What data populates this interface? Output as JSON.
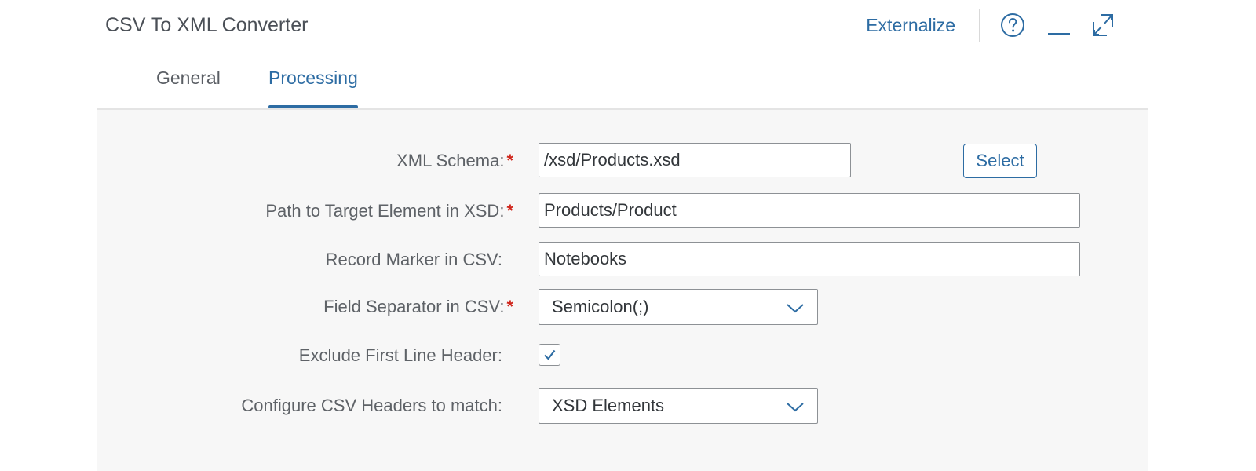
{
  "header": {
    "title": "CSV To XML Converter",
    "externalize_label": "Externalize",
    "icons": [
      "help-icon",
      "minimize-icon",
      "maximize-icon"
    ]
  },
  "tabs": [
    {
      "label": "General",
      "active": false
    },
    {
      "label": "Processing",
      "active": true
    }
  ],
  "form": {
    "xml_schema": {
      "label": "XML Schema:",
      "required": true,
      "value": "/xsd/Products.xsd",
      "button_label": "Select"
    },
    "target_path": {
      "label": "Path to Target Element in XSD:",
      "required": true,
      "value": "Products/Product"
    },
    "record_marker": {
      "label": "Record Marker in CSV:",
      "required": false,
      "value": "Notebooks"
    },
    "field_separator": {
      "label": "Field Separator in CSV:",
      "required": true,
      "value": "Semicolon(;)"
    },
    "exclude_header": {
      "label": "Exclude First Line Header:",
      "required": false,
      "checked": true
    },
    "configure_headers": {
      "label": "Configure CSV Headers to match:",
      "required": false,
      "value": "XSD Elements"
    }
  },
  "colors": {
    "accent": "#2d6ca3",
    "required": "#d0271d",
    "content_bg": "#f7f7f7"
  }
}
